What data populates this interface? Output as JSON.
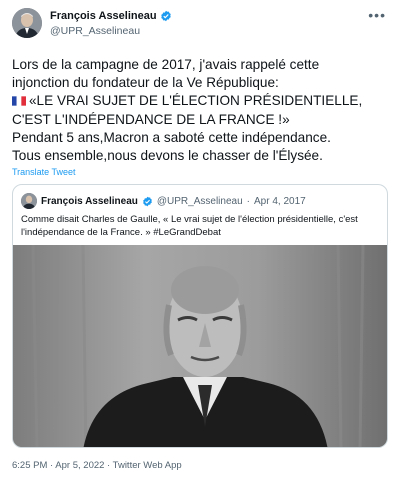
{
  "author": {
    "name": "François Asselineau",
    "handle": "@UPR_Asselineau"
  },
  "tweet": {
    "lines": [
      "Lors de la campagne de 2017, j'avais rappelé cette",
      "injonction du fondateur de la Ve République:",
      "«LE VRAI SUJET DE L'ÉLECTION PRÉSIDENTIELLE,",
      "C'EST L'INDÉPENDANCE DE LA FRANCE !»",
      "Pendant 5 ans,Macron a saboté cette indépendance.",
      "Tous ensemble,nous devons le chasser de l'Élysée."
    ],
    "translate_label": "Translate Tweet"
  },
  "quote": {
    "name": "François Asselineau",
    "handle": "@UPR_Asselineau",
    "separator": "·",
    "date": "Apr 4, 2017",
    "lines": [
      "Comme disait Charles de Gaulle, « Le vrai sujet de l'élection présidentielle, c'est",
      "l'indépendance de la France. » #LeGrandDebat"
    ]
  },
  "footer": "6:25 PM · Apr 5, 2022 · Twitter Web App",
  "icons": {
    "verified": "verified-badge-icon",
    "more": "more-options-icon",
    "flag": "france-flag-icon"
  },
  "colors": {
    "verified": "#1d9bf0",
    "link": "#1d9bf0",
    "secondary_text": "#536471",
    "border": "#cfd9de"
  }
}
